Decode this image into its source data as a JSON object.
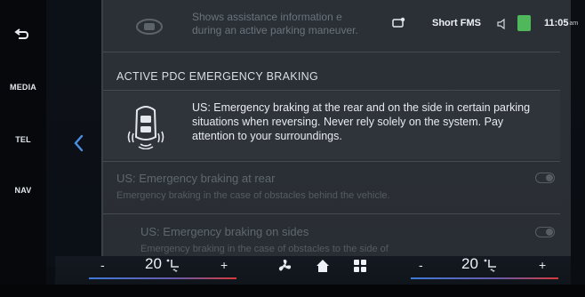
{
  "sidebar": {
    "items": [
      {
        "label": "MEDIA"
      },
      {
        "label": "TEL"
      },
      {
        "label": "NAV"
      }
    ]
  },
  "status_bar": {
    "profile": "Short FMS",
    "time": "11:05",
    "time_suffix": "am"
  },
  "faded_row": {
    "line1": "Shows assistance information e",
    "line2": "during an active parking maneuver."
  },
  "section": {
    "title": "ACTIVE PDC EMERGENCY BRAKING"
  },
  "info_card": {
    "text": "US: Emergency braking at the rear and on the side in certain parking situations when reversing. Never rely solely on the system. Pay attention to your surroundings."
  },
  "options": [
    {
      "title": "US: Emergency braking at rear",
      "subtitle": "Emergency braking in the case of obstacles behind the vehicle.",
      "enabled": false
    },
    {
      "title": "US: Emergency braking on sides",
      "subtitle": "Emergency braking in the case of obstacles to the side of",
      "enabled": false
    }
  ],
  "climate": {
    "left_minus": "-",
    "left_temp": "20",
    "left_plus": "+",
    "right_minus": "-",
    "right_temp": "20",
    "right_plus": "+"
  },
  "colors": {
    "accent_blue": "#3f7ad8",
    "accent_red": "#d83a3a",
    "panel": "#2b3037",
    "green_icon": "#4fb85a"
  }
}
